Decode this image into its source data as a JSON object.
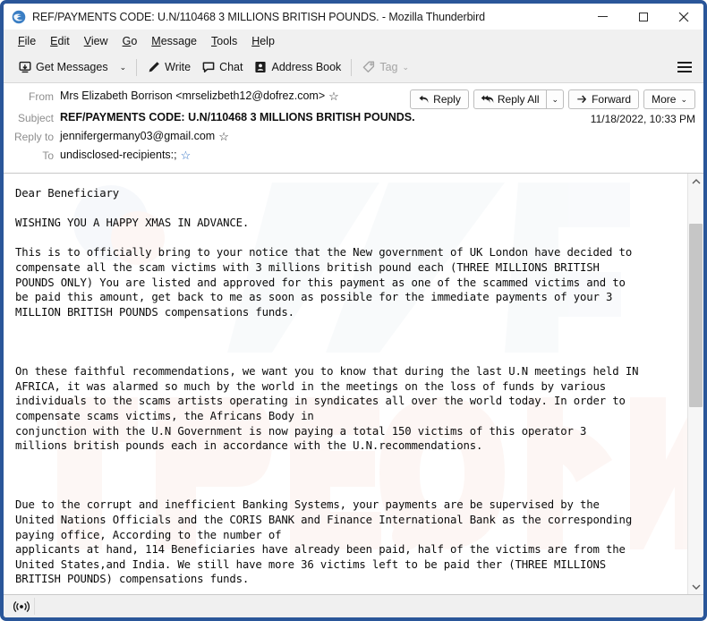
{
  "window": {
    "title": "REF/PAYMENTS CODE: U.N/110468 3 MILLIONS BRITISH POUNDS. - Mozilla Thunderbird",
    "app_icon": "thunderbird-icon",
    "controls": {
      "minimize": "minimize-button",
      "maximize": "maximize-button",
      "close": "close-button"
    },
    "accent_color": "#2a5699"
  },
  "menubar": {
    "items": [
      {
        "label": "File",
        "accesskey": "F"
      },
      {
        "label": "Edit",
        "accesskey": "E"
      },
      {
        "label": "View",
        "accesskey": "V"
      },
      {
        "label": "Go",
        "accesskey": "G"
      },
      {
        "label": "Message",
        "accesskey": "M"
      },
      {
        "label": "Tools",
        "accesskey": "T"
      },
      {
        "label": "Help",
        "accesskey": "H"
      }
    ]
  },
  "toolbar": {
    "get_messages": "Get Messages",
    "get_messages_caret": "⌄",
    "write": "Write",
    "chat": "Chat",
    "address_book": "Address Book",
    "tag": "Tag",
    "tag_caret": "⌄",
    "tag_disabled": true,
    "app_menu": "app-menu-button"
  },
  "message_header": {
    "from_label": "From",
    "from_value": "Mrs Elizabeth Borrison <mrselizbeth12@dofrez.com>",
    "subject_label": "Subject",
    "subject_value": "REF/PAYMENTS CODE: U.N/110468 3 MILLIONS BRITISH POUNDS.",
    "reply_to_label": "Reply to",
    "reply_to_value": "jennifergermany03@gmail.com",
    "to_label": "To",
    "to_value": "undisclosed-recipients:;",
    "date": "11/18/2022, 10:33 PM",
    "star_glyph": "☆"
  },
  "actions": {
    "reply": "Reply",
    "reply_all": "Reply All",
    "reply_all_caret": "⌄",
    "forward": "Forward",
    "more": "More",
    "more_caret": "⌄"
  },
  "message_body": {
    "text": "Dear Beneficiary\n\nWISHING YOU A HAPPY XMAS IN ADVANCE.\n\nThis is to officially bring to your notice that the New government of UK London have decided to\ncompensate all the scam victims with 3 millions british pound each (THREE MILLIONS BRITISH\nPOUNDS ONLY) You are listed and approved for this payment as one of the scammed victims and to\nbe paid this amount, get back to me as soon as possible for the immediate payments of your 3\nMILLION BRITISH POUNDS compensations funds.\n\n\n\nOn these faithful recommendations, we want you to know that during the last U.N meetings held IN\nAFRICA, it was alarmed so much by the world in the meetings on the loss of funds by various\nindividuals to the scams artists operating in syndicates all over the world today. In order to\ncompensate scams victims, the Africans Body in\nconjunction with the U.N Government is now paying a total 150 victims of this operator 3\nmillions british pounds each in accordance with the U.N.recommendations.\n\n\n\nDue to the corrupt and inefficient Banking Systems, your payments are be supervised by the\nUnited Nations Officials and the CORIS BANK and Finance International Bank as the corresponding\npaying office, According to the number of\napplicants at hand, 114 Beneficiaries have already been paid, half of the victims are from the\nUnited States,and India. We still have more 36 victims left to be paid ther (THREE MILLIONS\nBRITISH POUNDS) compensations funds."
  },
  "scrollbar": {
    "up_arrow": "scroll-up-arrow",
    "down_arrow": "scroll-down-arrow",
    "thumb_top_pct": 9,
    "thumb_height_pct": 47
  },
  "statusbar": {
    "indicator": "broadcast-icon"
  }
}
